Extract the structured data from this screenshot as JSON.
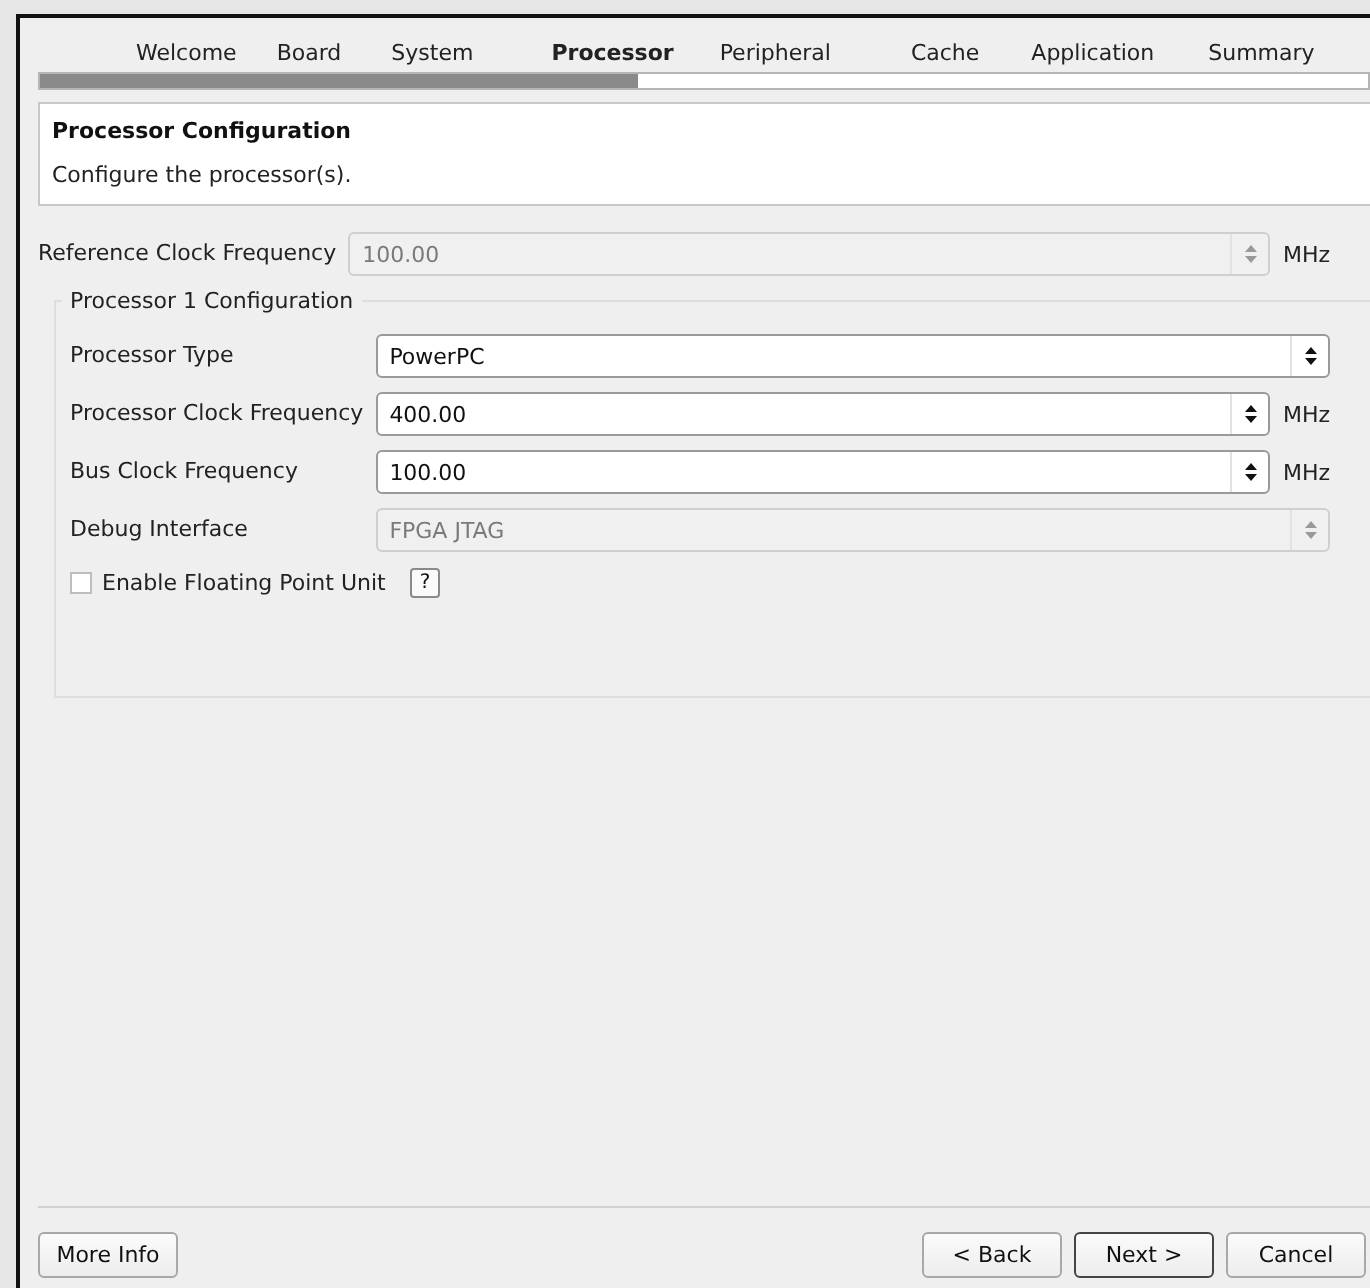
{
  "tabs": [
    {
      "label": "Welcome",
      "selected": false
    },
    {
      "label": "Board",
      "selected": false
    },
    {
      "label": "System",
      "selected": false
    },
    {
      "label": "Processor",
      "selected": true
    },
    {
      "label": "Peripheral",
      "selected": false
    },
    {
      "label": "Cache",
      "selected": false
    },
    {
      "label": "Application",
      "selected": false
    },
    {
      "label": "Summary",
      "selected": false
    }
  ],
  "progress": {
    "level": 0.45
  },
  "header": {
    "title": "Processor Configuration",
    "subtitle": "Configure the processor(s)."
  },
  "reference": {
    "kind": "spin",
    "label": "Reference Clock Frequency",
    "value": "100.00",
    "unit": "MHz",
    "disabled": true
  },
  "group": {
    "title": "Processor 1 Configuration",
    "rows": [
      {
        "kind": "combo",
        "label": "Processor Type",
        "value": "PowerPC",
        "disabled": false
      },
      {
        "kind": "spin",
        "label": "Processor Clock Frequency",
        "value": "400.00",
        "unit": "MHz",
        "disabled": false
      },
      {
        "kind": "spin",
        "label": "Bus Clock Frequency",
        "value": "100.00",
        "unit": "MHz",
        "disabled": false
      },
      {
        "kind": "combo",
        "label": "Debug Interface",
        "value": "FPGA JTAG",
        "disabled": true
      }
    ],
    "checkbox": {
      "label": "Enable Floating Point Unit",
      "checked": false,
      "help": "?"
    }
  },
  "buttons": [
    {
      "label": "More Info",
      "default": false
    },
    {
      "label": "< Back",
      "default": false
    },
    {
      "label": "Next >",
      "default": true
    },
    {
      "label": "Cancel",
      "default": false
    }
  ]
}
